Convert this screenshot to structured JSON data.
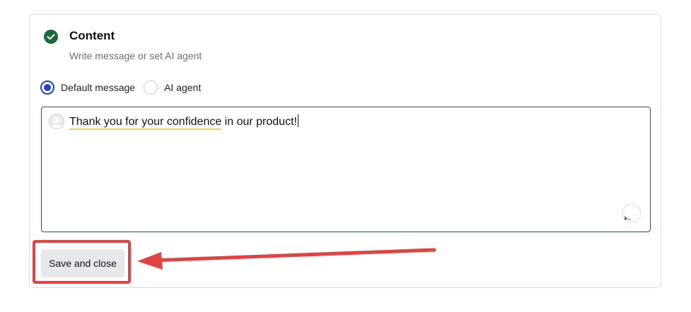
{
  "section": {
    "title": "Content",
    "subtitle": "Write message or set AI agent",
    "status_icon": "check-circle-icon",
    "status_color": "#1b6b3d"
  },
  "radio": {
    "options": [
      {
        "label": "Default message",
        "selected": true
      },
      {
        "label": "AI agent",
        "selected": false
      }
    ],
    "accent_color": "#1f3fd6"
  },
  "editor": {
    "message_highlighted": "Thank you for your confidence",
    "message_rest": " in our product!",
    "avatar_icon": "user-avatar-icon",
    "assistant_icon": "chat-assistant-icon",
    "assistant_color": "#127a64"
  },
  "actions": {
    "save_label": "Save and close"
  },
  "annotation": {
    "color": "#e34242",
    "arrow_icon": "arrow-left-icon"
  }
}
